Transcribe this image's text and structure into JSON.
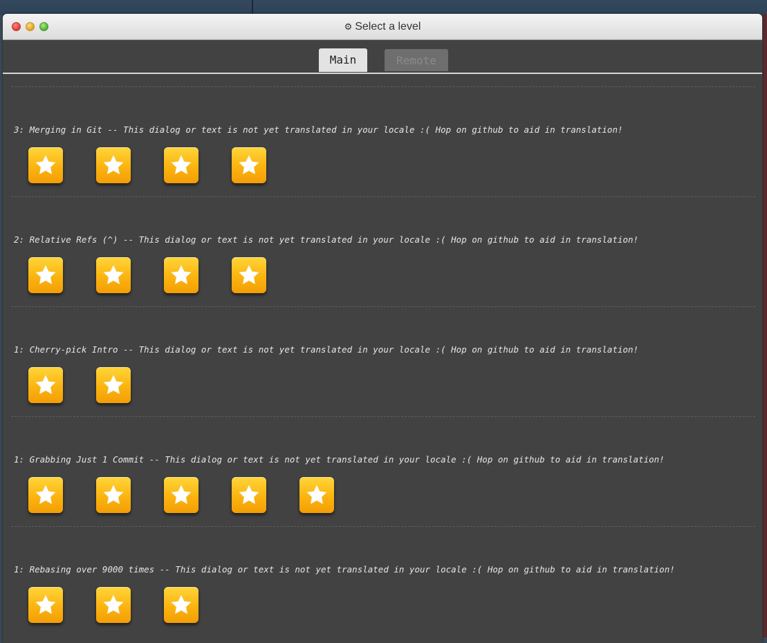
{
  "window": {
    "title": "Select a level",
    "title_icon": "gear-icon"
  },
  "tabs": [
    {
      "label": "Main",
      "active": true
    },
    {
      "label": "Remote",
      "active": false
    }
  ],
  "levels": [
    {
      "title": "3: Merging in Git -- This dialog or text is not yet translated in your locale :( Hop on github to aid in translation!",
      "stars": 4
    },
    {
      "title": "2: Relative Refs (^) -- This dialog or text is not yet translated in your locale :( Hop on github to aid in translation!",
      "stars": 4
    },
    {
      "title": "1: Cherry-pick Intro -- This dialog or text is not yet translated in your locale :( Hop on github to aid in translation!",
      "stars": 2
    },
    {
      "title": "1: Grabbing Just 1 Commit -- This dialog or text is not yet translated in your locale :( Hop on github to aid in translation!",
      "stars": 5
    },
    {
      "title": "1: Rebasing over 9000 times -- This dialog or text is not yet translated in your locale :( Hop on github to aid in translation!",
      "stars": 3
    }
  ],
  "colors": {
    "star_button": "#fbb40f",
    "star_fill": "#ffffff",
    "panel_bg": "#424242",
    "text": "#e6e6e6"
  }
}
